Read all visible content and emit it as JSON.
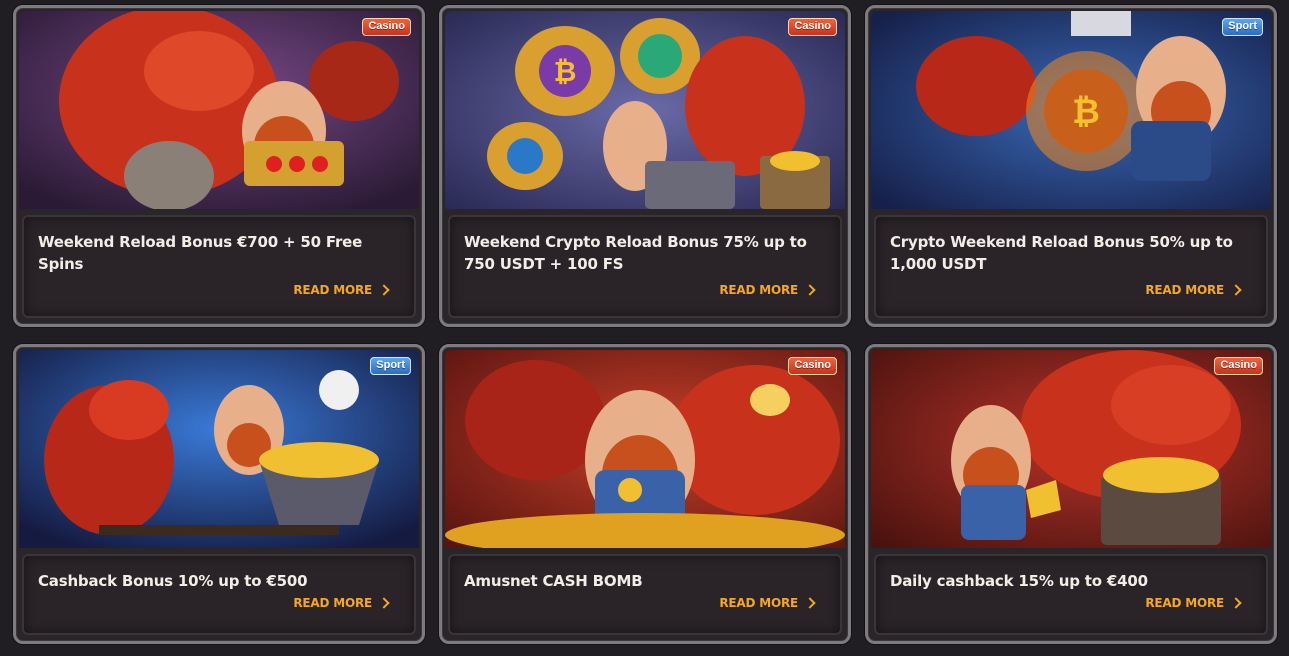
{
  "promotions": [
    {
      "badge": "Casino",
      "title": "Weekend Reload Bonus €700 + 50 Free Spins",
      "cta": "READ MORE",
      "art": "dragon-with-dwarf-slot-machine"
    },
    {
      "badge": "Casino",
      "title": "Weekend Crypto Reload Bonus 75% up to 750 USDT + 100 FS",
      "cta": "READ MORE",
      "art": "dragon-dwarf-crypto-money-bags"
    },
    {
      "badge": "Sport",
      "title": "Crypto Weekend Reload Bonus 50% up to 1,000 USDT",
      "cta": "READ MORE",
      "art": "dragon-dwarf-basketball-bitcoin"
    },
    {
      "badge": "Sport",
      "title": "Cashback Bonus 10% up to €500",
      "cta": "READ MORE",
      "art": "dragon-dwarf-mine-cart-football"
    },
    {
      "badge": "Casino",
      "title": "Amusnet CASH BOMB",
      "cta": "READ MORE",
      "art": "dragon-dwarf-gold-coins"
    },
    {
      "badge": "Casino",
      "title": "Daily cashback 15% up to €400",
      "cta": "READ MORE",
      "art": "dragon-dwarf-treasure-chest"
    }
  ],
  "colors": {
    "background": "#201d23",
    "accent": "#f5a623",
    "casino_badge": "#e04a2a",
    "sport_badge": "#3f86d8"
  }
}
